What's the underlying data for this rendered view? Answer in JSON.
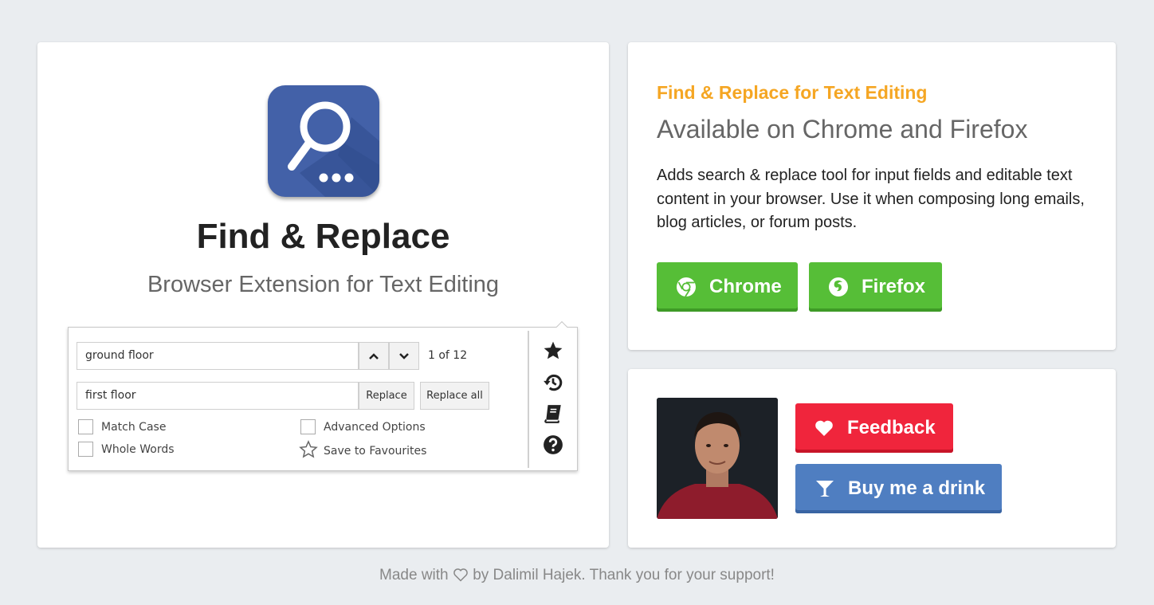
{
  "main": {
    "title": "Find & Replace",
    "subtitle": "Browser Extension for Text Editing",
    "preview": {
      "find_value": "ground floor",
      "replace_value": "first floor",
      "match_count": "1 of 12",
      "replace_label": "Replace",
      "replace_all_label": "Replace all",
      "options": {
        "match_case": "Match Case",
        "whole_words": "Whole Words",
        "advanced_options": "Advanced Options",
        "save_to_favourites": "Save to Favourites"
      },
      "side_icons": [
        "star-icon",
        "history-icon",
        "book-icon",
        "help-icon"
      ]
    }
  },
  "info": {
    "tagline": "Find & Replace for Text Editing",
    "headline": "Available on Chrome and Firefox",
    "description": "Adds search & replace tool for input fields and editable text content in your browser. Use it when composing long emails, blog articles, or forum posts.",
    "buttons": {
      "chrome": "Chrome",
      "firefox": "Firefox"
    }
  },
  "author": {
    "feedback_label": "Feedback",
    "drink_label": "Buy me a drink"
  },
  "footer": {
    "prefix": "Made with",
    "suffix": "by Dalimil Hajek. Thank you for your support!"
  },
  "colors": {
    "background": "#eaedf0",
    "accent_orange": "#f5a623",
    "green": "#56be37",
    "red": "#f0253c",
    "blue": "#4f7ec1",
    "icon_blue": "#4361a8"
  }
}
